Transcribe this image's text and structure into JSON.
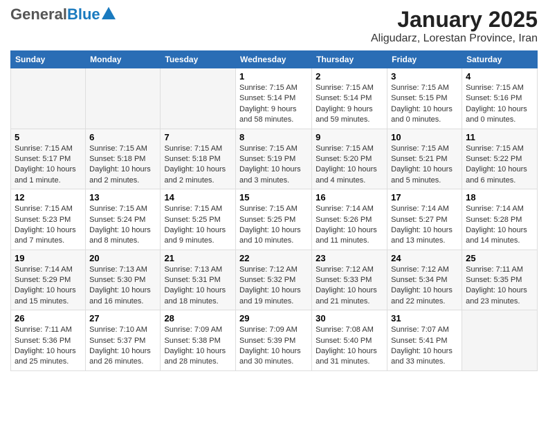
{
  "header": {
    "logo_general": "General",
    "logo_blue": "Blue",
    "title": "January 2025",
    "subtitle": "Aligudarz, Lorestan Province, Iran"
  },
  "days": [
    "Sunday",
    "Monday",
    "Tuesday",
    "Wednesday",
    "Thursday",
    "Friday",
    "Saturday"
  ],
  "weeks": [
    [
      {
        "date": "",
        "info": ""
      },
      {
        "date": "",
        "info": ""
      },
      {
        "date": "",
        "info": ""
      },
      {
        "date": "1",
        "info": "Sunrise: 7:15 AM\nSunset: 5:14 PM\nDaylight: 9 hours and 58 minutes."
      },
      {
        "date": "2",
        "info": "Sunrise: 7:15 AM\nSunset: 5:14 PM\nDaylight: 9 hours and 59 minutes."
      },
      {
        "date": "3",
        "info": "Sunrise: 7:15 AM\nSunset: 5:15 PM\nDaylight: 10 hours and 0 minutes."
      },
      {
        "date": "4",
        "info": "Sunrise: 7:15 AM\nSunset: 5:16 PM\nDaylight: 10 hours and 0 minutes."
      }
    ],
    [
      {
        "date": "5",
        "info": "Sunrise: 7:15 AM\nSunset: 5:17 PM\nDaylight: 10 hours and 1 minute."
      },
      {
        "date": "6",
        "info": "Sunrise: 7:15 AM\nSunset: 5:18 PM\nDaylight: 10 hours and 2 minutes."
      },
      {
        "date": "7",
        "info": "Sunrise: 7:15 AM\nSunset: 5:18 PM\nDaylight: 10 hours and 2 minutes."
      },
      {
        "date": "8",
        "info": "Sunrise: 7:15 AM\nSunset: 5:19 PM\nDaylight: 10 hours and 3 minutes."
      },
      {
        "date": "9",
        "info": "Sunrise: 7:15 AM\nSunset: 5:20 PM\nDaylight: 10 hours and 4 minutes."
      },
      {
        "date": "10",
        "info": "Sunrise: 7:15 AM\nSunset: 5:21 PM\nDaylight: 10 hours and 5 minutes."
      },
      {
        "date": "11",
        "info": "Sunrise: 7:15 AM\nSunset: 5:22 PM\nDaylight: 10 hours and 6 minutes."
      }
    ],
    [
      {
        "date": "12",
        "info": "Sunrise: 7:15 AM\nSunset: 5:23 PM\nDaylight: 10 hours and 7 minutes."
      },
      {
        "date": "13",
        "info": "Sunrise: 7:15 AM\nSunset: 5:24 PM\nDaylight: 10 hours and 8 minutes."
      },
      {
        "date": "14",
        "info": "Sunrise: 7:15 AM\nSunset: 5:25 PM\nDaylight: 10 hours and 9 minutes."
      },
      {
        "date": "15",
        "info": "Sunrise: 7:15 AM\nSunset: 5:25 PM\nDaylight: 10 hours and 10 minutes."
      },
      {
        "date": "16",
        "info": "Sunrise: 7:14 AM\nSunset: 5:26 PM\nDaylight: 10 hours and 11 minutes."
      },
      {
        "date": "17",
        "info": "Sunrise: 7:14 AM\nSunset: 5:27 PM\nDaylight: 10 hours and 13 minutes."
      },
      {
        "date": "18",
        "info": "Sunrise: 7:14 AM\nSunset: 5:28 PM\nDaylight: 10 hours and 14 minutes."
      }
    ],
    [
      {
        "date": "19",
        "info": "Sunrise: 7:14 AM\nSunset: 5:29 PM\nDaylight: 10 hours and 15 minutes."
      },
      {
        "date": "20",
        "info": "Sunrise: 7:13 AM\nSunset: 5:30 PM\nDaylight: 10 hours and 16 minutes."
      },
      {
        "date": "21",
        "info": "Sunrise: 7:13 AM\nSunset: 5:31 PM\nDaylight: 10 hours and 18 minutes."
      },
      {
        "date": "22",
        "info": "Sunrise: 7:12 AM\nSunset: 5:32 PM\nDaylight: 10 hours and 19 minutes."
      },
      {
        "date": "23",
        "info": "Sunrise: 7:12 AM\nSunset: 5:33 PM\nDaylight: 10 hours and 21 minutes."
      },
      {
        "date": "24",
        "info": "Sunrise: 7:12 AM\nSunset: 5:34 PM\nDaylight: 10 hours and 22 minutes."
      },
      {
        "date": "25",
        "info": "Sunrise: 7:11 AM\nSunset: 5:35 PM\nDaylight: 10 hours and 23 minutes."
      }
    ],
    [
      {
        "date": "26",
        "info": "Sunrise: 7:11 AM\nSunset: 5:36 PM\nDaylight: 10 hours and 25 minutes."
      },
      {
        "date": "27",
        "info": "Sunrise: 7:10 AM\nSunset: 5:37 PM\nDaylight: 10 hours and 26 minutes."
      },
      {
        "date": "28",
        "info": "Sunrise: 7:09 AM\nSunset: 5:38 PM\nDaylight: 10 hours and 28 minutes."
      },
      {
        "date": "29",
        "info": "Sunrise: 7:09 AM\nSunset: 5:39 PM\nDaylight: 10 hours and 30 minutes."
      },
      {
        "date": "30",
        "info": "Sunrise: 7:08 AM\nSunset: 5:40 PM\nDaylight: 10 hours and 31 minutes."
      },
      {
        "date": "31",
        "info": "Sunrise: 7:07 AM\nSunset: 5:41 PM\nDaylight: 10 hours and 33 minutes."
      },
      {
        "date": "",
        "info": ""
      }
    ]
  ]
}
